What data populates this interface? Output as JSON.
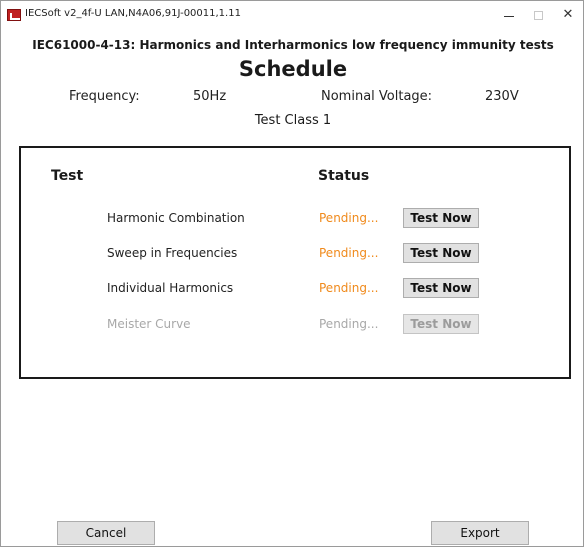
{
  "window": {
    "title": "IECSoft v2_4f-U    LAN,N4A06,91J-00011,1.11",
    "minimize_label": "",
    "maximize_label": "",
    "close_label": "✕"
  },
  "header": {
    "subtitle": "IEC61000-4-13: Harmonics and Interharmonics low frequency immunity tests",
    "title": "Schedule",
    "frequency_label": "Frequency:",
    "frequency_value": "50Hz",
    "voltage_label": "Nominal Voltage:",
    "voltage_value": "230V",
    "test_class": "Test Class 1"
  },
  "table": {
    "col_test": "Test",
    "col_status": "Status",
    "rows": [
      {
        "name": "Harmonic Combination",
        "status": "Pending...",
        "button": "Test Now",
        "enabled": true
      },
      {
        "name": "Sweep in Frequencies",
        "status": "Pending...",
        "button": "Test Now",
        "enabled": true
      },
      {
        "name": "Individual Harmonics",
        "status": "Pending...",
        "button": "Test Now",
        "enabled": true
      },
      {
        "name": "Meister Curve",
        "status": "Pending...",
        "button": "Test Now",
        "enabled": false
      }
    ]
  },
  "footer": {
    "cancel_label": "Cancel",
    "export_label": "Export"
  },
  "colors": {
    "pending": "#f08a1c",
    "disabled_text": "#a8a8a8",
    "button_face": "#e1e1e1"
  },
  "icons": {
    "app": "app-logo-icon",
    "minimize": "minimize-icon",
    "maximize": "maximize-icon",
    "close": "close-icon"
  }
}
